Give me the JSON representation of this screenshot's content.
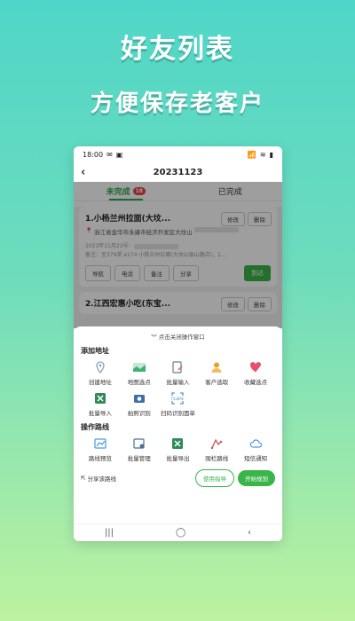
{
  "promo": {
    "title": "好友列表",
    "subtitle": "方便保存老客户"
  },
  "status": {
    "time": "18:00",
    "battery": "▮"
  },
  "header": {
    "back": "‹",
    "title": "20231123"
  },
  "tabs": [
    {
      "label": "未完成",
      "badge": "18"
    },
    {
      "label": "已完成"
    }
  ],
  "card1": {
    "name": "1.小杨兰州拉面(大坟...",
    "edit": "修改",
    "delete": "删除",
    "address": "浙江省金华市永康市经济开发区大坟山",
    "date": "2023年11月23号：",
    "note": "备注：至379单 e174 小杨兰州拉面(大坟山银山路店)，1...",
    "actions": [
      "导航",
      "电话",
      "备注",
      "分享"
    ],
    "arrive": "到达"
  },
  "card2": {
    "name": "2.江西宏惠小吃(东宝...",
    "edit": "修改",
    "delete": "删除"
  },
  "sheet": {
    "close_label": "点击关闭操作窗口",
    "add_section": "添加地址",
    "add_items": [
      {
        "label": "创建地址",
        "icon": "location-pin-icon",
        "color": "#8aa0b4"
      },
      {
        "label": "地图选点",
        "icon": "map-icon",
        "color": "#3cb371"
      },
      {
        "label": "批量输入",
        "icon": "document-edit-icon",
        "color": "#6d7c8c"
      },
      {
        "label": "客户选取",
        "icon": "user-icon",
        "color": "#f0a020"
      },
      {
        "label": "收藏选点",
        "icon": "heart-icon",
        "color": "#e8506a"
      },
      {
        "label": "批量导入",
        "icon": "excel-icon",
        "color": "#2e8b57"
      },
      {
        "label": "拍照识别",
        "icon": "camera-icon",
        "color": "#3f6fa8"
      },
      {
        "label": "扫码识别面单",
        "icon": "ocr-scan-icon",
        "color": "#5a8fd0"
      }
    ],
    "route_section": "操作路线",
    "route_items": [
      {
        "label": "路线预览",
        "icon": "route-preview-icon",
        "color": "#4b9be0"
      },
      {
        "label": "批量管理",
        "icon": "settings-icon",
        "color": "#4a6fa0"
      },
      {
        "label": "批量导出",
        "icon": "excel-icon",
        "color": "#2e8b57"
      },
      {
        "label": "围栏路线",
        "icon": "fence-route-icon",
        "color": "#d05050"
      },
      {
        "label": "短信通知",
        "icon": "cloud-message-icon",
        "color": "#4b9be0"
      }
    ],
    "share_label": "分享该路线",
    "guide_label": "使用指导",
    "plan_label": "开始规划"
  },
  "nav": {
    "recents": "|||",
    "home": "◯",
    "back": "‹"
  }
}
